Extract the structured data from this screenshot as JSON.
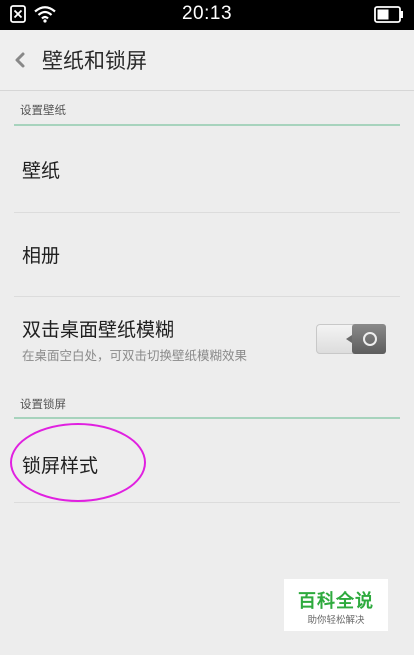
{
  "status_bar": {
    "time": "20:13",
    "icons": [
      "sim-off-icon",
      "wifi-icon",
      "battery-icon"
    ]
  },
  "header": {
    "back_icon": "chevron-left-icon",
    "title": "壁纸和锁屏"
  },
  "sections": [
    {
      "header": "设置壁纸",
      "items": [
        {
          "label": "壁纸"
        },
        {
          "label": "相册"
        },
        {
          "label": "双击桌面壁纸模糊",
          "sublabel": "在桌面空白处，可双击切换壁纸模糊效果",
          "toggle": "off"
        }
      ]
    },
    {
      "header": "设置锁屏",
      "items": [
        {
          "label": "锁屏样式"
        }
      ]
    }
  ],
  "annotation": {
    "color": "#e020e0",
    "shape": "ellipse",
    "target": "锁屏样式"
  },
  "watermark": {
    "title": "百科全说",
    "subtitle": "助你轻松解决",
    "color": "#2eaa3e"
  },
  "colors": {
    "section_divider": "#a7d3bd",
    "background": "#ededed"
  }
}
